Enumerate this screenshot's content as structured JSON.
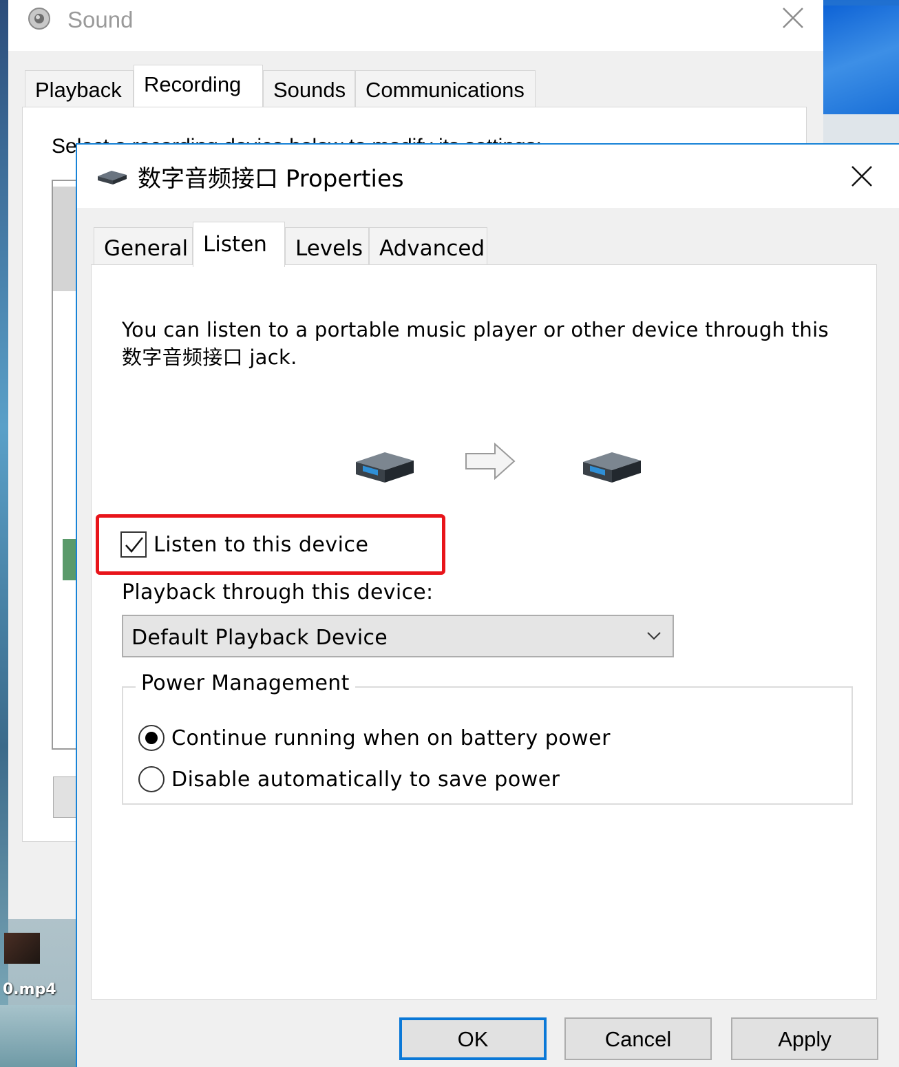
{
  "desktop": {
    "file_label": "0.mp4"
  },
  "sound_window": {
    "title": "Sound",
    "tabs": [
      {
        "label": "Playback"
      },
      {
        "label": "Recording"
      },
      {
        "label": "Sounds"
      },
      {
        "label": "Communications"
      }
    ],
    "active_tab": "Recording",
    "hint_text": "Select a recording device below to modify its settings:"
  },
  "dialog": {
    "title": "数字音频接口 Properties",
    "tabs": [
      {
        "label": "General"
      },
      {
        "label": "Listen"
      },
      {
        "label": "Levels"
      },
      {
        "label": "Advanced"
      }
    ],
    "active_tab": "Listen",
    "description": "You can listen to a portable music player or other device through this 数字音频接口 jack.",
    "listen_checkbox": {
      "label": "Listen to this device",
      "checked": true
    },
    "playback_label": "Playback through this device:",
    "playback_select": {
      "value": "Default Playback Device"
    },
    "power_management": {
      "title": "Power Management",
      "options": [
        {
          "label": "Continue running when on battery power",
          "selected": true
        },
        {
          "label": "Disable automatically to save power",
          "selected": false
        }
      ]
    },
    "buttons": {
      "ok": "OK",
      "cancel": "Cancel",
      "apply": "Apply"
    }
  },
  "colors": {
    "highlight": "#e8141a",
    "accent": "#0a78d7"
  },
  "icons": {
    "sound": "speaker-icon",
    "device": "audio-device-icon",
    "arrow": "arrow-right-icon",
    "close": "close-icon",
    "chevron": "chevron-down-icon"
  }
}
